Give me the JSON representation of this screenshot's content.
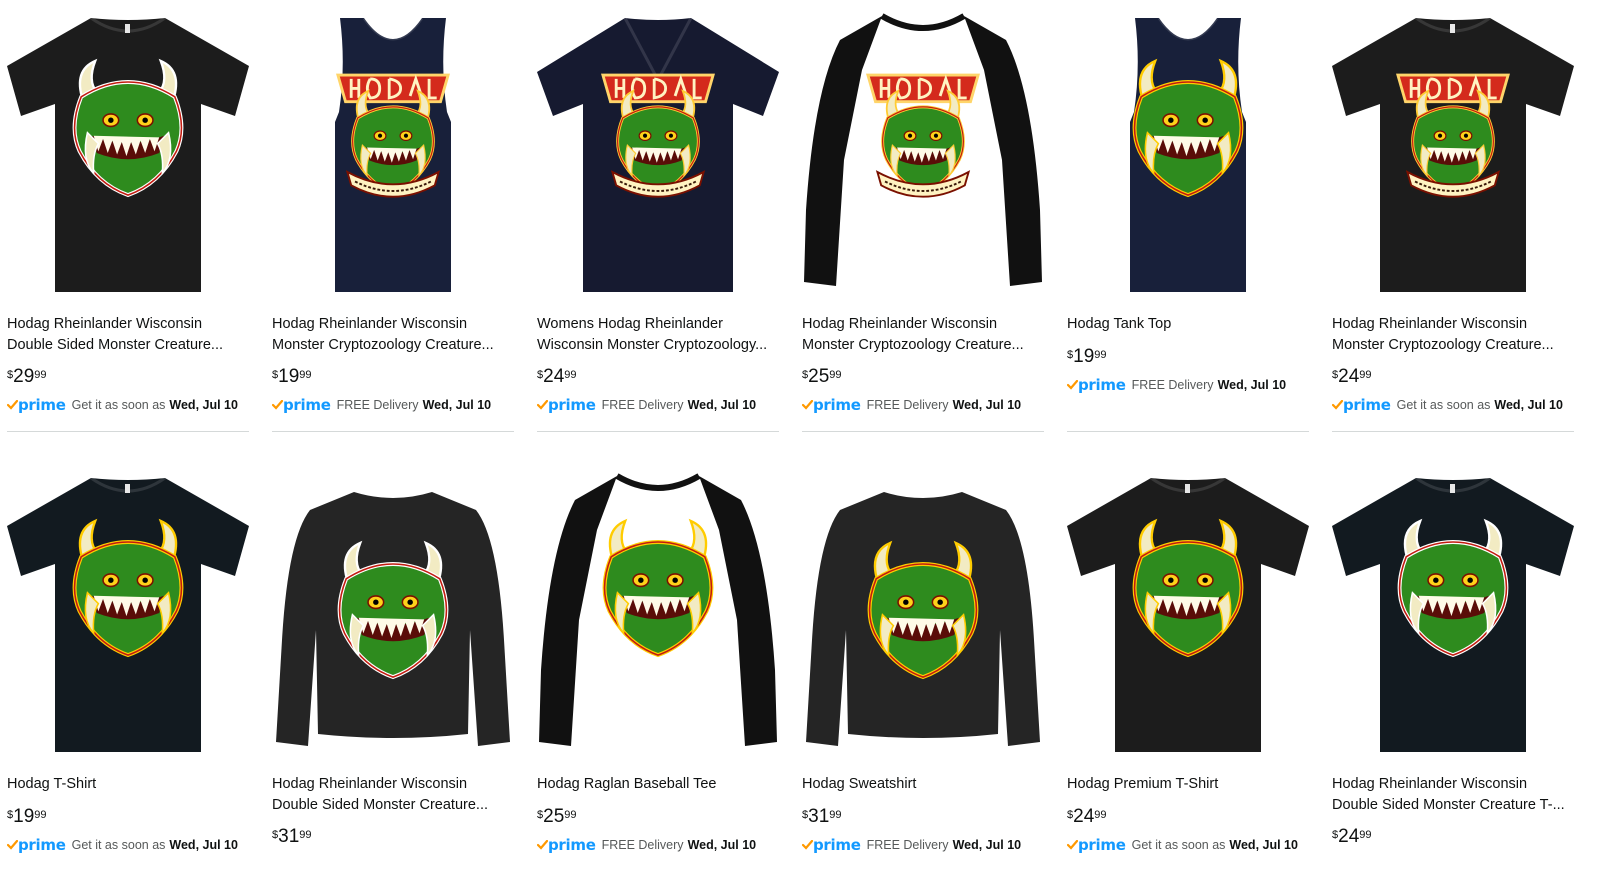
{
  "colors": {
    "prime_blue": "#1399ff",
    "prime_check": "#ff9900",
    "text": "#0f1111",
    "secondary_text": "#565959",
    "monster_green": "#2e8b1e",
    "tusk": "#f2ebc3",
    "logo_red": "#d42a1c"
  },
  "prime_label": "prime",
  "products": [
    {
      "title_line1": "Hodag Rheinlander Wisconsin",
      "title_line2": "Double Sided Monster Creature...",
      "price_symbol": "$",
      "price_whole": "29",
      "price_fraction": "99",
      "delivery_text": "Get it as soon as",
      "delivery_date": "Wed, Jul 10",
      "garment": "tshirt",
      "garment_color": "#1c1c1c",
      "design": "face",
      "design_outline": "#ffffff"
    },
    {
      "title_line1": "Hodag Rheinlander Wisconsin",
      "title_line2": "Monster Cryptozoology Creature...",
      "price_symbol": "$",
      "price_whole": "19",
      "price_fraction": "99",
      "delivery_text": "FREE Delivery",
      "delivery_date": "Wed, Jul 10",
      "garment": "tank",
      "garment_color": "#18203a",
      "design": "logo",
      "design_outline": "#ffcc33"
    },
    {
      "title_line1": "Womens Hodag Rheinlander",
      "title_line2": "Wisconsin Monster Cryptozoology...",
      "price_symbol": "$",
      "price_whole": "24",
      "price_fraction": "99",
      "delivery_text": "FREE Delivery",
      "delivery_date": "Wed, Jul 10",
      "garment": "vneck",
      "garment_color": "#161a30",
      "design": "logo",
      "design_outline": "#ffcc33"
    },
    {
      "title_line1": "Hodag Rheinlander Wisconsin",
      "title_line2": "Monster Cryptozoology Creature...",
      "price_symbol": "$",
      "price_whole": "25",
      "price_fraction": "99",
      "delivery_text": "FREE Delivery",
      "delivery_date": "Wed, Jul 10",
      "garment": "raglan",
      "garment_color": "#111111",
      "design": "logo",
      "design_outline": "#ffcc33"
    },
    {
      "title_line1": "Hodag Tank Top",
      "title_line2": "",
      "price_symbol": "$",
      "price_whole": "19",
      "price_fraction": "99",
      "delivery_text": "FREE Delivery",
      "delivery_date": "Wed, Jul 10",
      "garment": "tank",
      "garment_color": "#18203a",
      "design": "face",
      "design_outline": "#ffcc00"
    },
    {
      "title_line1": "Hodag Rheinlander Wisconsin",
      "title_line2": "Monster Cryptozoology Creature...",
      "price_symbol": "$",
      "price_whole": "24",
      "price_fraction": "99",
      "delivery_text": "Get it as soon as",
      "delivery_date": "Wed, Jul 10",
      "garment": "tshirt",
      "garment_color": "#1c1c1c",
      "design": "logo",
      "design_outline": "#ffcc33"
    },
    {
      "title_line1": "Hodag T-Shirt",
      "title_line2": "",
      "price_symbol": "$",
      "price_whole": "19",
      "price_fraction": "99",
      "delivery_text": "Get it as soon as",
      "delivery_date": "Wed, Jul 10",
      "garment": "tshirt",
      "garment_color": "#121a20",
      "design": "face",
      "design_outline": "#ffcc00"
    },
    {
      "title_line1": "Hodag Rheinlander Wisconsin",
      "title_line2": "Double Sided Monster Creature...",
      "price_symbol": "$",
      "price_whole": "31",
      "price_fraction": "99",
      "delivery_text": "",
      "delivery_date": "",
      "garment": "sweatshirt",
      "garment_color": "#252525",
      "design": "face",
      "design_outline": "#ffffff"
    },
    {
      "title_line1": "Hodag Raglan Baseball Tee",
      "title_line2": "",
      "price_symbol": "$",
      "price_whole": "25",
      "price_fraction": "99",
      "delivery_text": "FREE Delivery",
      "delivery_date": "Wed, Jul 10",
      "garment": "raglan",
      "garment_color": "#111111",
      "design": "face",
      "design_outline": "#ffcc00"
    },
    {
      "title_line1": "Hodag Sweatshirt",
      "title_line2": "",
      "price_symbol": "$",
      "price_whole": "31",
      "price_fraction": "99",
      "delivery_text": "FREE Delivery",
      "delivery_date": "Wed, Jul 10",
      "garment": "sweatshirt",
      "garment_color": "#252525",
      "design": "face",
      "design_outline": "#ffcc00"
    },
    {
      "title_line1": "Hodag Premium T-Shirt",
      "title_line2": "",
      "price_symbol": "$",
      "price_whole": "24",
      "price_fraction": "99",
      "delivery_text": "Get it as soon as",
      "delivery_date": "Wed, Jul 10",
      "garment": "tshirt",
      "garment_color": "#1c1c1c",
      "design": "face",
      "design_outline": "#ffcc00"
    },
    {
      "title_line1": "Hodag Rheinlander Wisconsin",
      "title_line2": "Double Sided Monster Creature T-...",
      "price_symbol": "$",
      "price_whole": "24",
      "price_fraction": "99",
      "delivery_text": "",
      "delivery_date": "",
      "garment": "tshirt",
      "garment_color": "#121a20",
      "design": "face",
      "design_outline": "#ffffff"
    }
  ]
}
